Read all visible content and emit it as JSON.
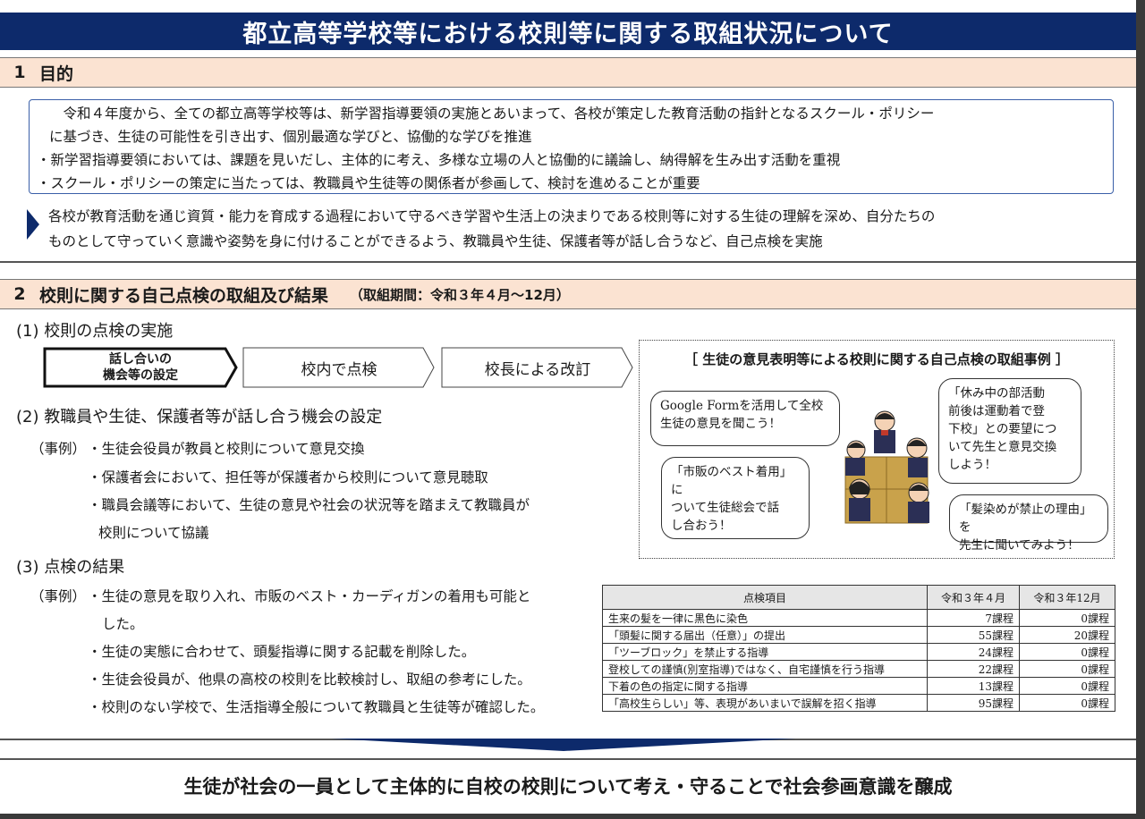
{
  "title": "都立高等学校等における校則等に関する取組状況について",
  "section1": {
    "num": "1",
    "heading": "目的",
    "box_lines": [
      "令和４年度から、全ての都立高等学校等は、新学習指導要領の実施とあいまって、各校が策定した教育活動の指針となるスクール・ポリシー",
      "に基づき、生徒の可能性を引き出す、個別最適な学びと、協働的な学びを推進",
      "・新学習指導要領においては、課題を見いだし、主体的に考え、多様な立場の人と協働的に議論し、納得解を生み出す活動を重視",
      "・スクール・ポリシーの策定に当たっては、教職員や生徒等の関係者が参画して、検討を進めることが重要"
    ],
    "arrow_lines": [
      "各校が教育活動を通じ資質・能力を育成する過程において守るべき学習や生活上の決まりである校則等に対する生徒の理解を深め、自分たちの",
      "ものとして守っていく意識や姿勢を身に付けることができるよう、教職員や生徒、保護者等が話し合うなど、自己点検を実施"
    ]
  },
  "section2": {
    "num": "2",
    "heading": "校則に関する自己点検の取組及び結果",
    "period": "（取組期間：令和３年４月～12月）",
    "sub1": "(1) 校則の点検の実施",
    "steps": [
      "話し合いの",
      "機会等の設定",
      "校内で点検",
      "校長による改訂"
    ],
    "sub2": "(2) 教職員や生徒、保護者等が話し合う機会の設定",
    "case_label": "（事例）",
    "sub2_items": [
      "・生徒会役員が教員と校則について意見交換",
      "・保護者会において、担任等が保護者から校則について意見聴取",
      "・職員会議等において、生徒の意見や社会の状況等を踏まえて教職員が",
      "校則について協議"
    ],
    "sub3": "(3) 点検の結果",
    "sub3_items": [
      "・生徒の意見を取り入れ、市販のベスト・カーディガンの着用も可能と",
      "した。",
      "・生徒の実態に合わせて、頭髪指導に関する記載を削除した。",
      "・生徒会役員が、他県の高校の校則を比較検討し、取組の参考にした。",
      "・校則のない学校で、生活指導全般について教職員と生徒等が確認した。"
    ],
    "example": {
      "title": "［ 生徒の意見表明等による校則に関する自己点検の取組事例 ］",
      "bubble1": [
        "Google Formを活用して全校",
        "生徒の意見を聞こう！"
      ],
      "bubble2": [
        "「市販のベスト着用」に",
        "ついて生徒総会で話",
        "し合おう！"
      ],
      "bubble3": [
        "「休み中の部活動",
        "前後は運動着で登",
        "下校」との要望につ",
        "いて先生と意見交換",
        "しよう！"
      ],
      "bubble4": [
        "「髪染めが禁止の理由」を",
        "先生に聞いてみよう！"
      ]
    },
    "table": {
      "headers": [
        "点検項目",
        "令和３年４月",
        "令和３年12月"
      ],
      "rows": [
        [
          "生来の髪を一律に黒色に染色",
          "7課程",
          "0課程"
        ],
        [
          "「頭髪に関する届出（任意）」の提出",
          "55課程",
          "20課程"
        ],
        [
          "「ツーブロック」を禁止する指導",
          "24課程",
          "0課程"
        ],
        [
          "登校しての謹慎(別室指導)ではなく、自宅謹慎を行う指導",
          "22課程",
          "0課程"
        ],
        [
          "下着の色の指定に関する指導",
          "13課程",
          "0課程"
        ],
        [
          "「高校生らしい」等、表現があいまいで誤解を招く指導",
          "95課程",
          "0課程"
        ]
      ]
    }
  },
  "conclusion": "生徒が社会の一員として主体的に自校の校則について考え・守ることで社会参画意識を醸成",
  "colors": {
    "navy": "#0d2a6b",
    "section_bg": "#fbe3d2",
    "box_border": "#3a5fa8"
  }
}
